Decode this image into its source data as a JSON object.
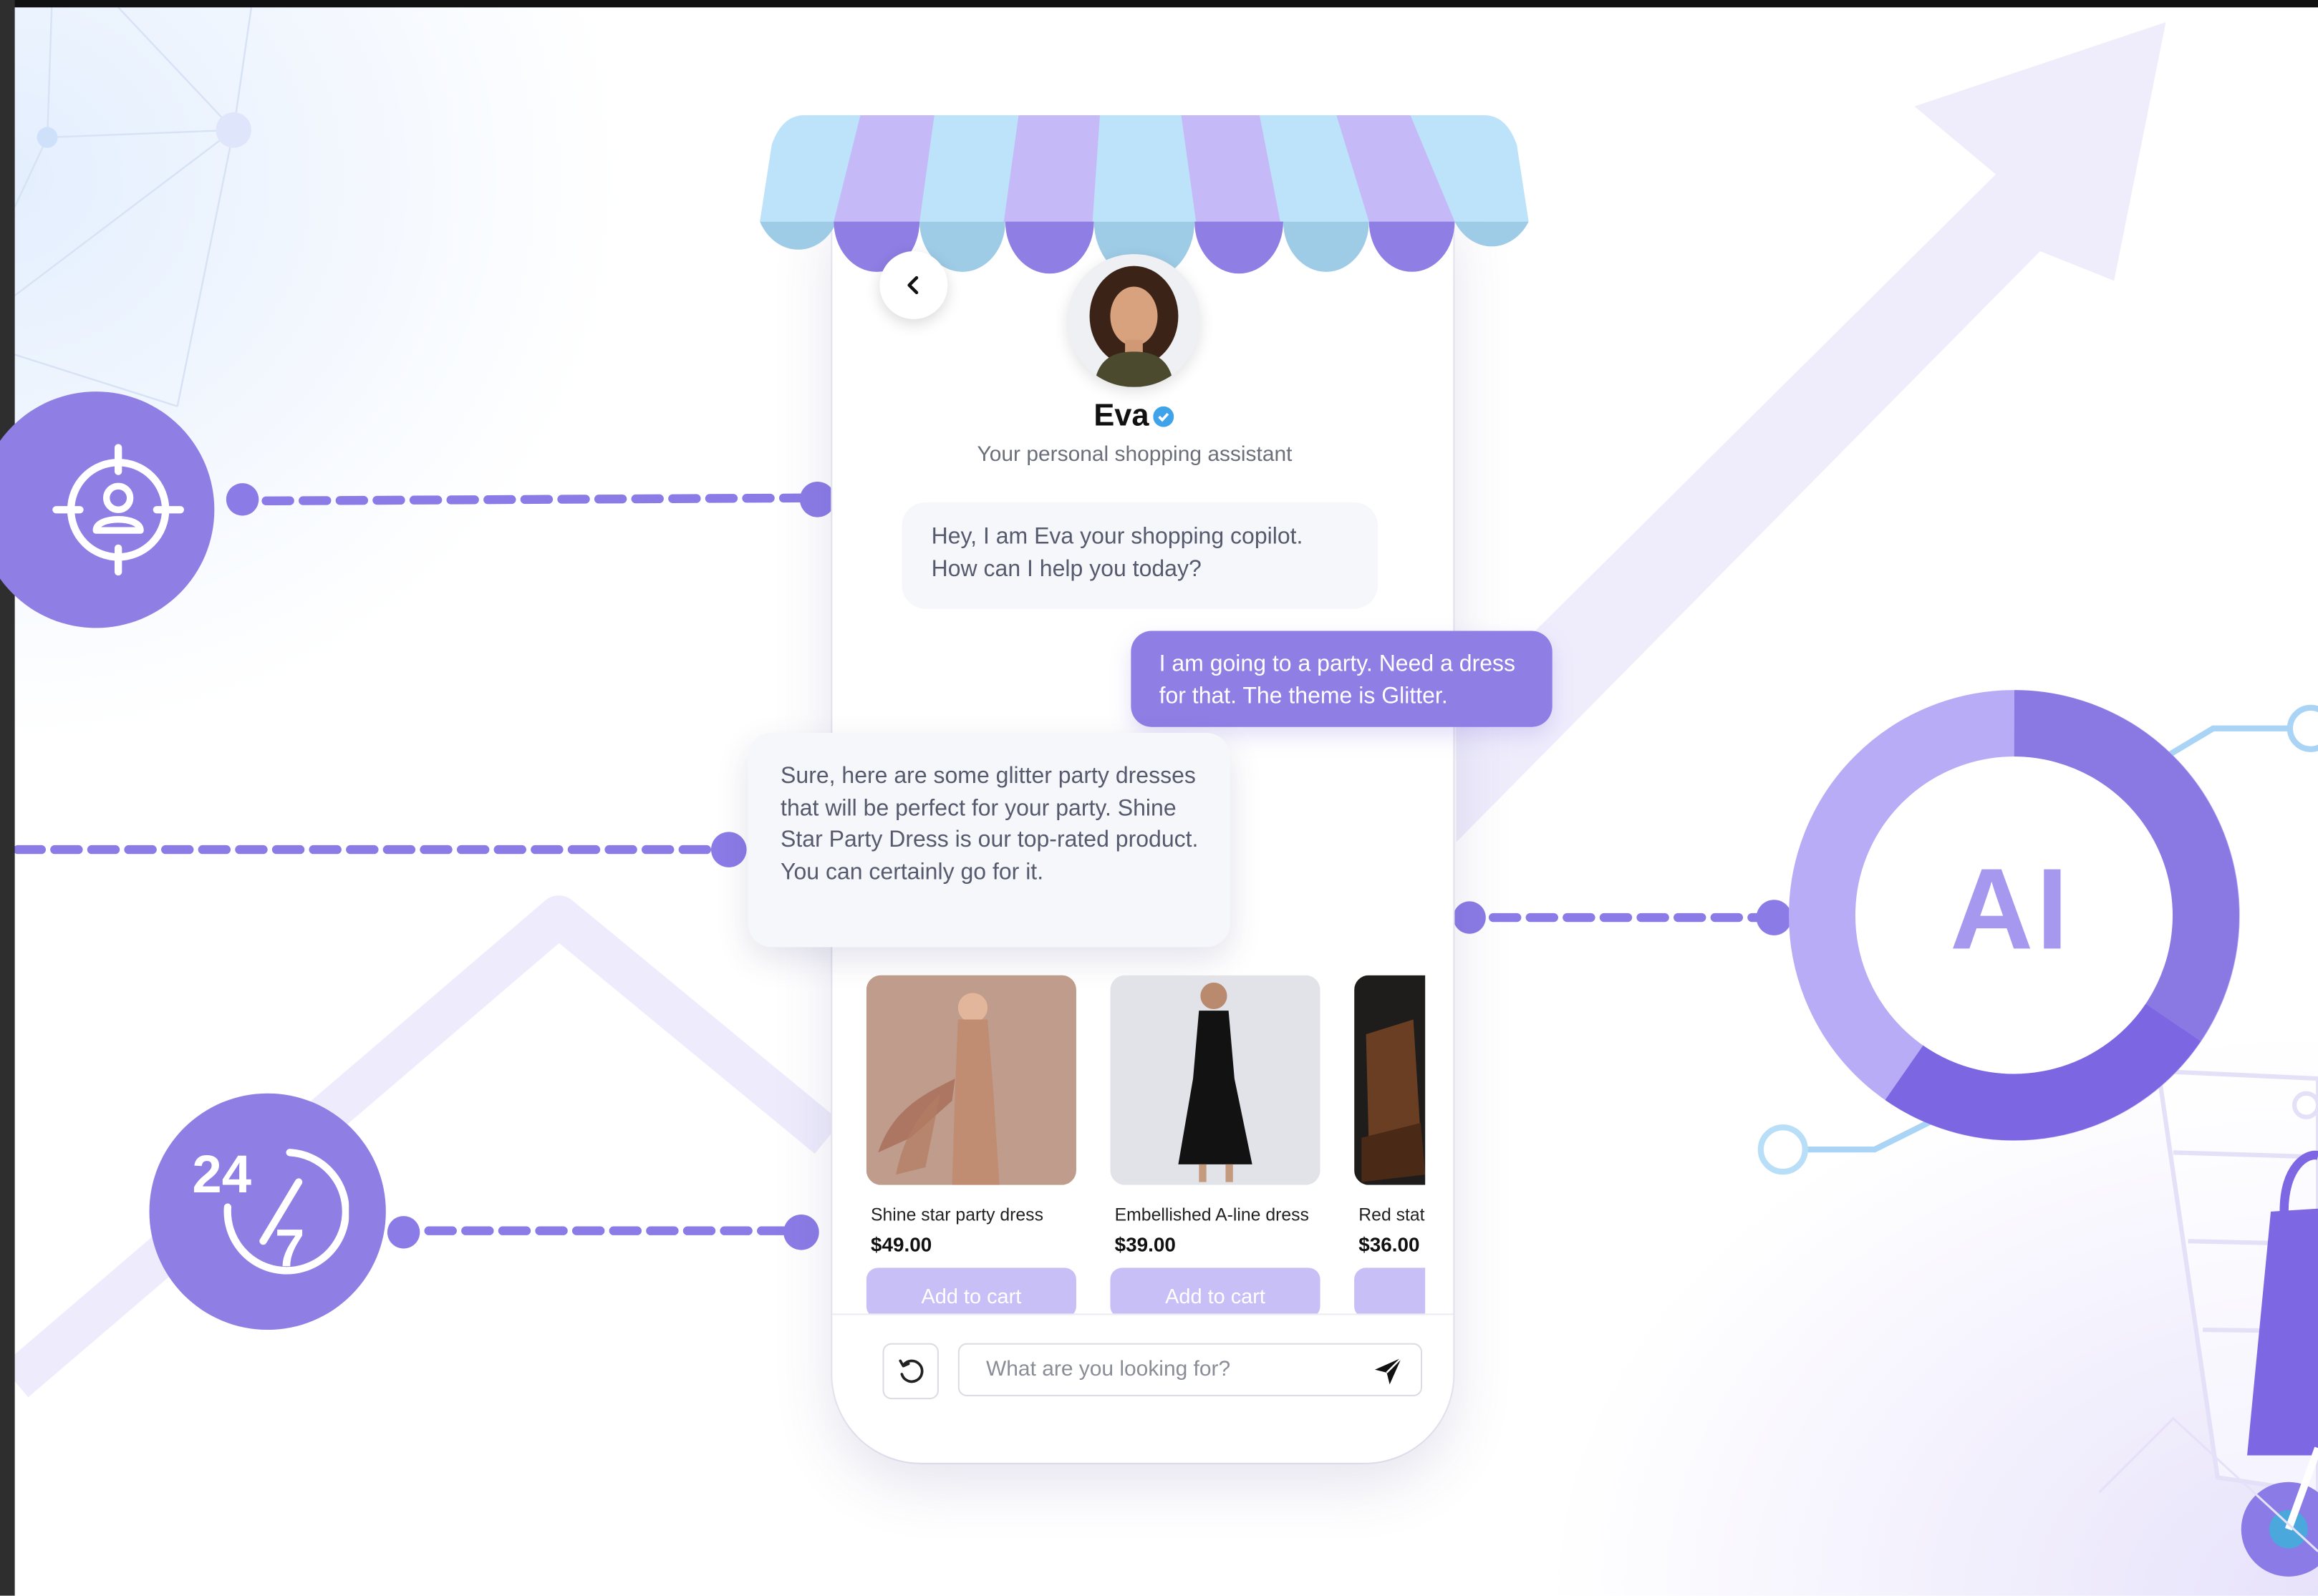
{
  "assistant": {
    "name": "Eva",
    "tagline": "Your personal shopping assistant"
  },
  "chat": {
    "messages": [
      {
        "role": "bot",
        "text": "Hey, I am Eva your shopping copilot. How can I help you today?"
      },
      {
        "role": "user",
        "text": "I am going to a party. Need a dress for that. The theme is Glitter."
      },
      {
        "role": "bot",
        "text": "Sure, here are some glitter party dresses that will be perfect for your party. Shine Star Party Dress is our top-rated product. You can certainly go for it."
      }
    ]
  },
  "products": [
    {
      "name": "Shine star party dress",
      "price": "$49.00",
      "button": "Add to cart"
    },
    {
      "name": "Embellished A-line dress",
      "price": "$39.00",
      "button": "Add to cart"
    },
    {
      "name": "Red state",
      "price": "$36.00",
      "button": ""
    }
  ],
  "input": {
    "placeholder": "What are you looking for?"
  },
  "features": {
    "ai_label": "AI",
    "support_icon": "24-7-icon",
    "target_icon": "target-user-icon"
  },
  "colors": {
    "accent": "#8f7ee4",
    "accent_light": "#c9bff7",
    "awning_blue": "#bde3fa",
    "awning_purple": "#c6b9f7"
  }
}
